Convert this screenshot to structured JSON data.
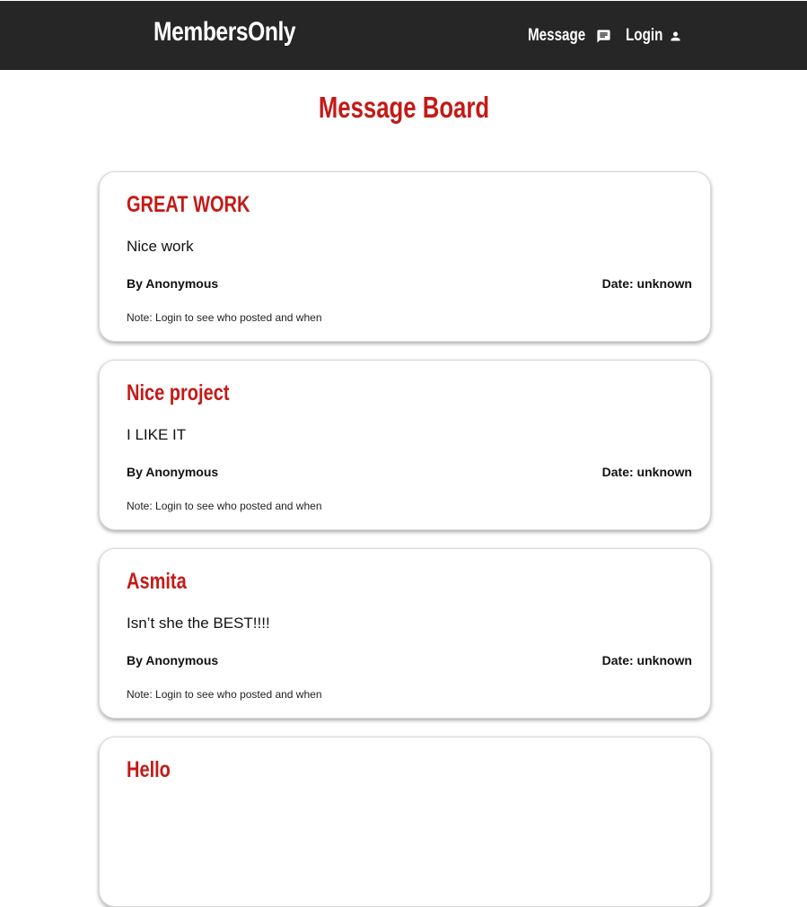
{
  "header": {
    "brand": "MembersOnly",
    "nav": [
      {
        "label": "Message",
        "icon": "message-icon"
      },
      {
        "label": "Login",
        "icon": "person-icon"
      }
    ]
  },
  "main": {
    "title": "Message Board",
    "messages": [
      {
        "title": "GREAT WORK",
        "body": "Nice work",
        "author": "By Anonymous",
        "date": "Date: unknown",
        "note": "Note: Login to see who posted and when"
      },
      {
        "title": "Nice project",
        "body": "I LIKE IT",
        "author": "By Anonymous",
        "date": "Date: unknown",
        "note": "Note: Login to see who posted and when"
      },
      {
        "title": "Asmita",
        "body": "Isn’t she the BEST!!!!",
        "author": "By Anonymous",
        "date": "Date: unknown",
        "note": "Note: Login to see who posted and when"
      },
      {
        "title": "Hello",
        "body": "",
        "author": "",
        "date": "",
        "note": ""
      }
    ]
  },
  "colors": {
    "navbar": "#262626",
    "accent": "#c41a16"
  }
}
